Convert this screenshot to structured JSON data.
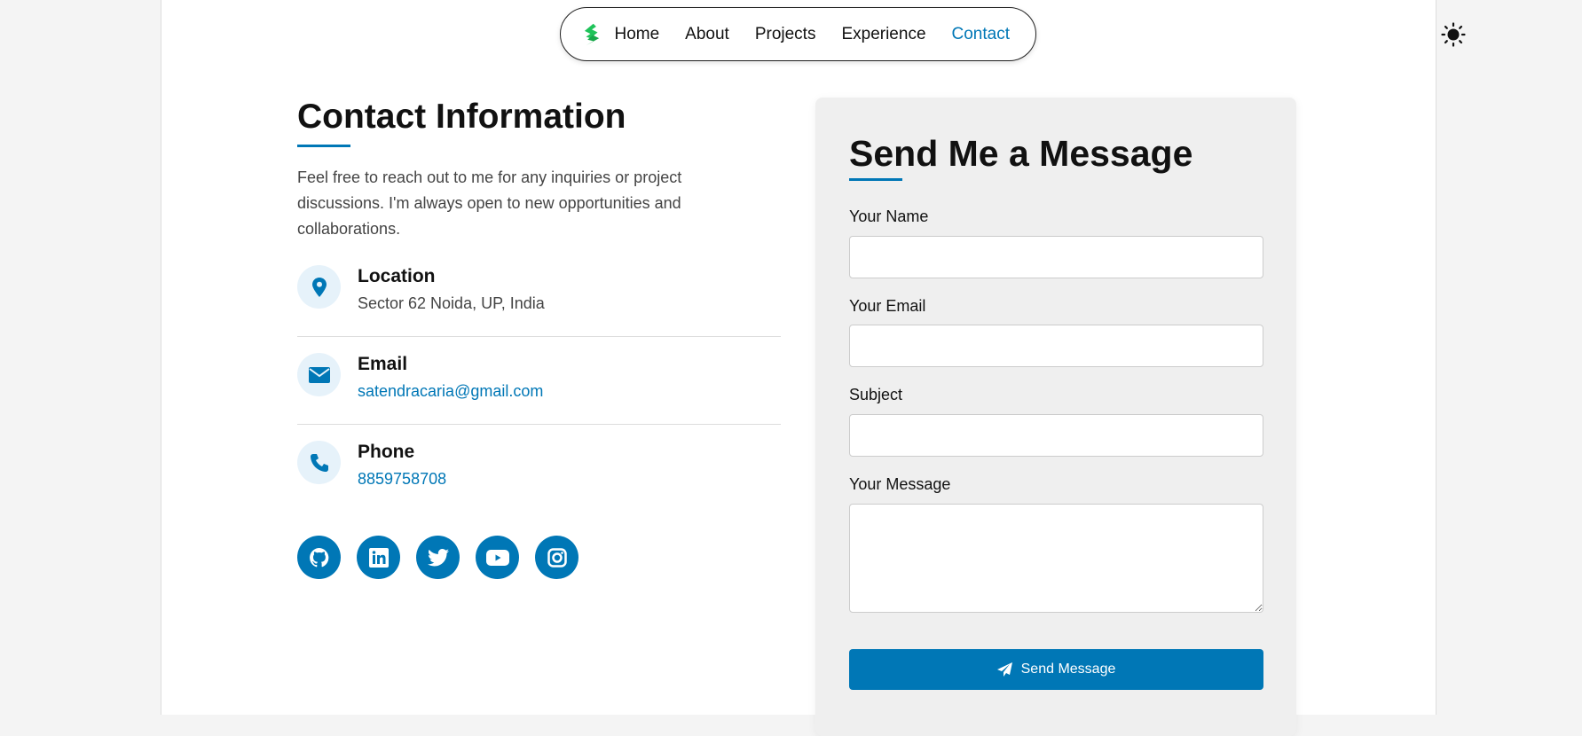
{
  "nav": {
    "items": [
      "Home",
      "About",
      "Projects",
      "Experience",
      "Contact"
    ],
    "active": "Contact"
  },
  "contact": {
    "title": "Contact Information",
    "intro": "Feel free to reach out to me for any inquiries or project discussions. I'm always open to new opportunities and collaborations.",
    "items": [
      {
        "title": "Location",
        "value": "Sector 62 Noida, UP, India"
      },
      {
        "title": "Email",
        "value": "satendracaria@gmail.com"
      },
      {
        "title": "Phone",
        "value": "8859758708"
      }
    ],
    "socials": [
      "github-icon",
      "linkedin-icon",
      "twitter-icon",
      "youtube-icon",
      "instagram-icon"
    ]
  },
  "form": {
    "title": "Send Me a Message",
    "name_label": "Your Name",
    "email_label": "Your Email",
    "subject_label": "Subject",
    "message_label": "Your Message",
    "submit": "Send Message"
  },
  "colors": {
    "accent": "#0077b6",
    "logo": "#1fc35a"
  }
}
